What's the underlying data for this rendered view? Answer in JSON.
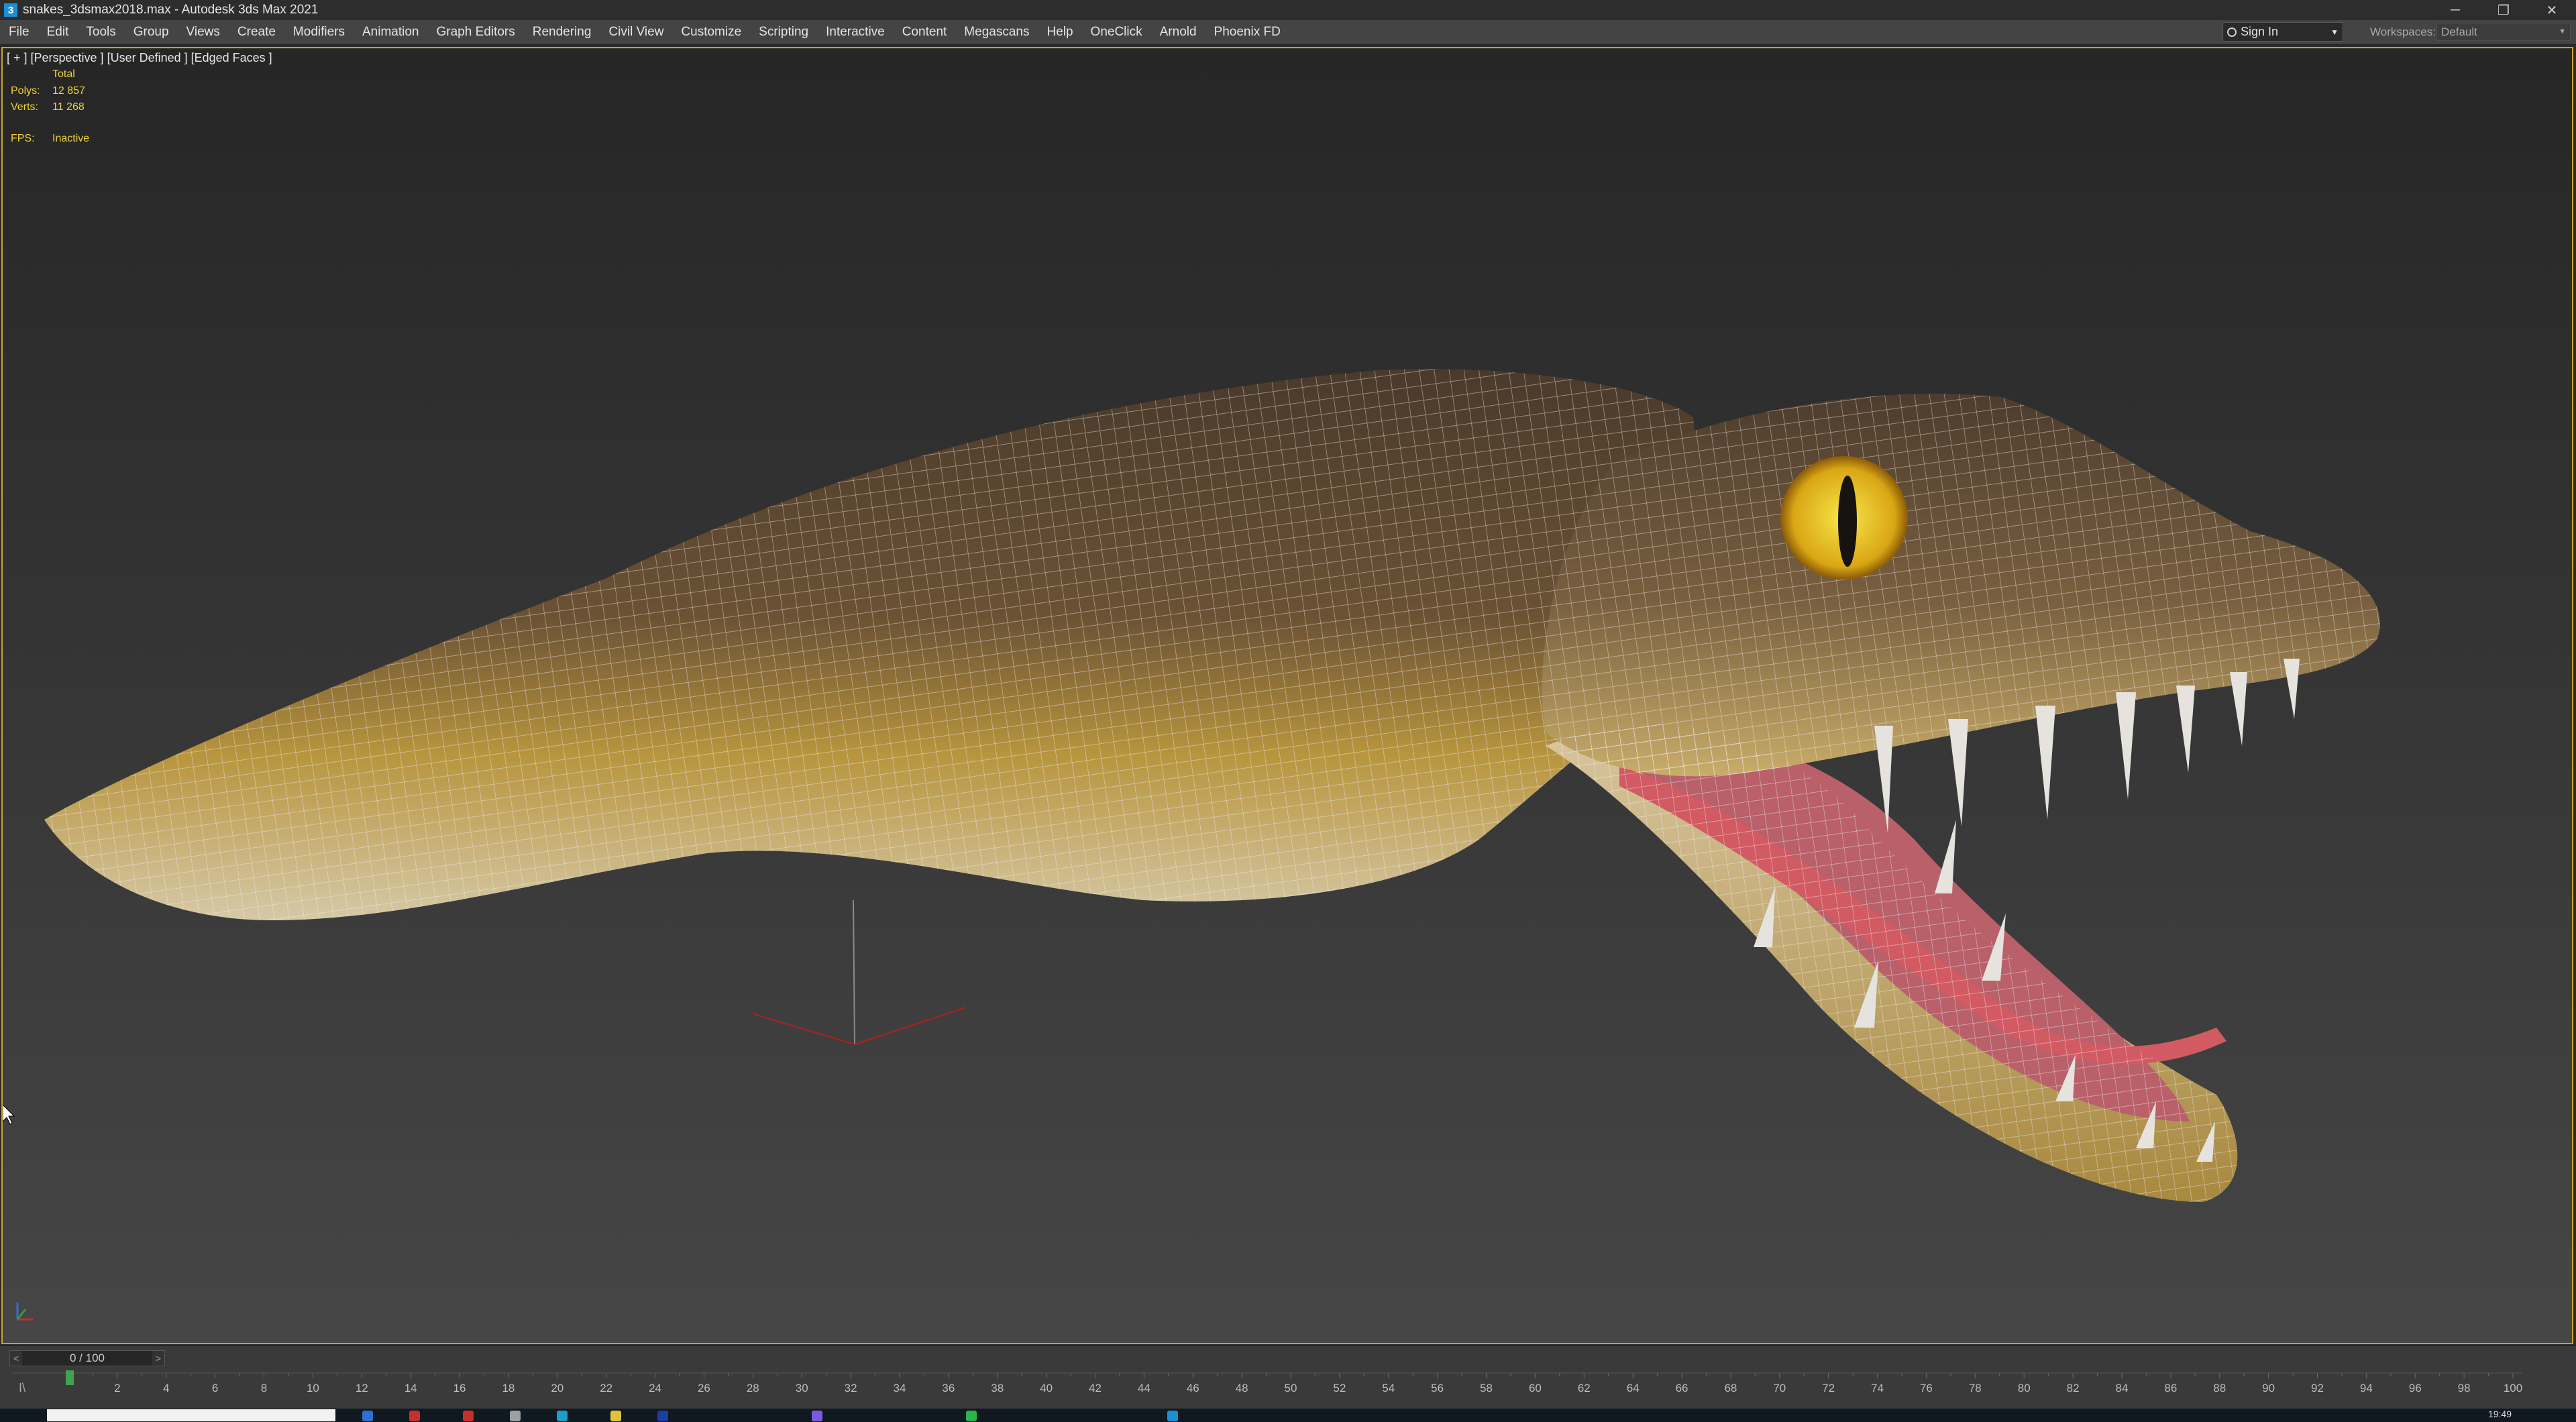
{
  "window": {
    "title": "snakes_3dsmax2018.max - Autodesk 3ds Max 2021",
    "app_icon_glyph": "3",
    "minimize": "─",
    "restore": "❐",
    "close": "✕"
  },
  "menubar": {
    "items": [
      "File",
      "Edit",
      "Tools",
      "Group",
      "Views",
      "Create",
      "Modifiers",
      "Animation",
      "Graph Editors",
      "Rendering",
      "Civil View",
      "Customize",
      "Scripting",
      "Interactive",
      "Content",
      "Megascans",
      "Help",
      "OneClick",
      "Arnold",
      "Phoenix FD"
    ],
    "sign_in": "Sign In",
    "workspaces_label": "Workspaces:",
    "workspaces_value": "Default"
  },
  "viewport": {
    "label": "[ + ] [Perspective ] [User Defined ] [Edged Faces ]",
    "stats": {
      "total_label": "Total",
      "polys_label": "Polys:",
      "polys_value": "12 857",
      "verts_label": "Verts:",
      "verts_value": "11 268",
      "fps_label": "FPS:",
      "fps_value": "Inactive"
    },
    "border_color": "#c8a32a",
    "stat_color": "#f0d23a"
  },
  "timeline": {
    "frame_display": "0 / 100",
    "prev_glyph": "<",
    "next_glyph": ">",
    "current_frame": 0,
    "ticks": [
      "2",
      "4",
      "6",
      "8",
      "10",
      "12",
      "14",
      "16",
      "18",
      "20",
      "22",
      "24",
      "26",
      "28",
      "30",
      "32",
      "34",
      "36",
      "38",
      "40",
      "42",
      "44",
      "46",
      "48",
      "50",
      "52",
      "54",
      "56",
      "58",
      "60",
      "62",
      "64",
      "66",
      "68",
      "70",
      "72",
      "74",
      "76",
      "78",
      "80",
      "82",
      "84",
      "86",
      "88",
      "90",
      "92",
      "94",
      "96",
      "98",
      "100"
    ]
  },
  "taskbar": {
    "clock": "19:49"
  },
  "icons": {
    "app": "3ds-max-icon",
    "user": "user-icon",
    "axis_gizmo": "axis-gizmo-icon",
    "cursor": "mouse-cursor-icon"
  }
}
